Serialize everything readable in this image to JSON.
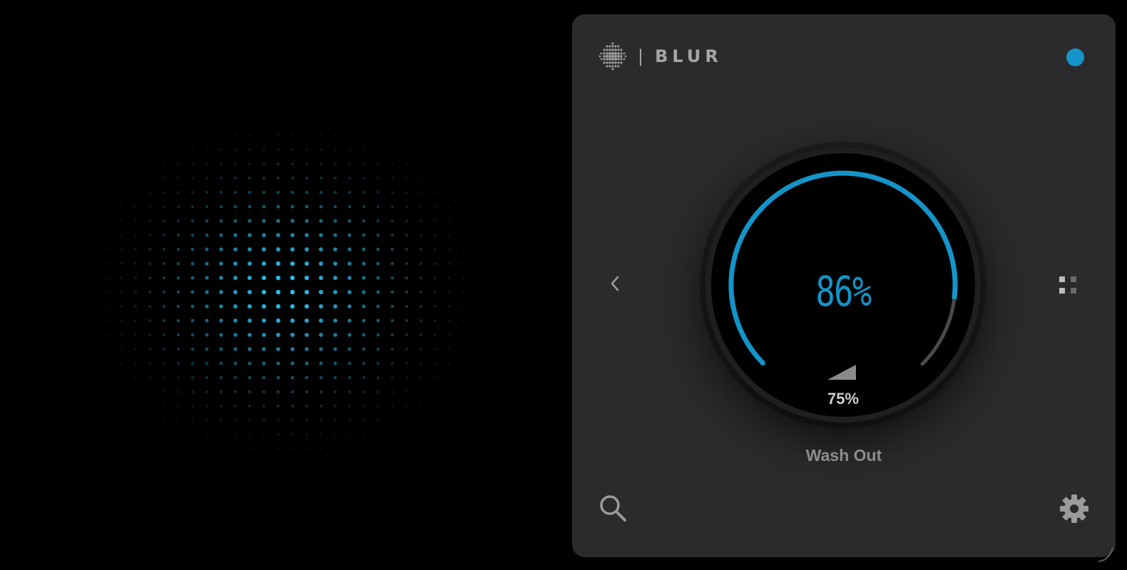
{
  "app": {
    "brand": "BLUR"
  },
  "knob": {
    "value_label": "86%",
    "value": 86,
    "sub_label": "75%",
    "sub_value": 75
  },
  "preset": {
    "name": "Wash Out"
  },
  "icons": {
    "logo": "dot-sphere-logo-icon",
    "status": "status-dot-icon",
    "prev": "chevron-left-icon",
    "view": "grid-view-icon",
    "search": "search-icon",
    "settings": "gear-icon",
    "resize": "resize-handle-icon",
    "level": "volume-wedge-icon"
  },
  "colors": {
    "accent": "#1494c8",
    "panel": "#2b2b2d",
    "track": "#4a4a4c",
    "muted": "#8c8c8c"
  }
}
